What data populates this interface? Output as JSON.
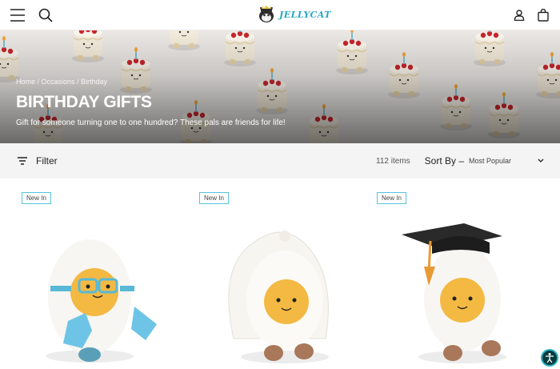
{
  "header": {
    "logo_text": "JELLYCAT",
    "icons": [
      "menu-icon",
      "search-icon",
      "account-icon",
      "bag-icon"
    ]
  },
  "hero": {
    "breadcrumb": "Home / Occasions / Birthday",
    "title": "BIRTHDAY GIFTS",
    "subtitle": "Gift for someone turning one to one hundred? These pals are friends for life!"
  },
  "toolbar": {
    "filter_label": "Filter",
    "count": "112 items",
    "sort_label": "Sort By –",
    "sort_value": "Most Popular"
  },
  "products": [
    {
      "badge": "New In",
      "icon": "swimmer-egg-plush"
    },
    {
      "badge": "New In",
      "icon": "bride-egg-plush"
    },
    {
      "badge": "New In",
      "icon": "graduate-egg-plush"
    }
  ],
  "colors": {
    "accent": "#56c3dc",
    "brand": "#29a7c4",
    "toolbar_bg": "#f4f4f4"
  }
}
